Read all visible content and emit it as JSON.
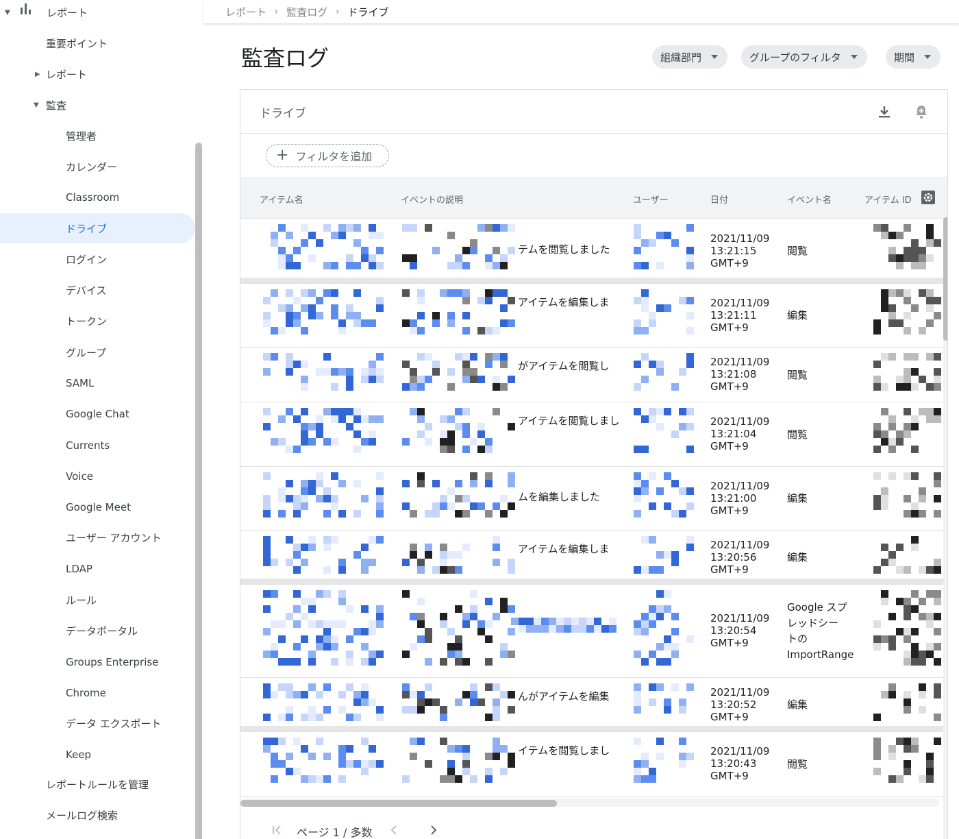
{
  "sidebar": {
    "reports_root": "レポート",
    "highlights": "重要ポイント",
    "reports": "レポート",
    "audit": "監査",
    "audit_items": [
      "管理者",
      "カレンダー",
      "Classroom",
      "ドライブ",
      "ログイン",
      "デバイス",
      "トークン",
      "グループ",
      "SAML",
      "Google Chat",
      "Currents",
      "Voice",
      "Google Meet",
      "ユーザー アカウント",
      "LDAP",
      "ルール",
      "データポータル",
      "Groups Enterprise",
      "Chrome",
      "データ エクスポート",
      "Keep"
    ],
    "active_item": "ドライブ",
    "manage_rules": "レポートルールを管理",
    "email_log": "メールログ検索"
  },
  "breadcrumb": [
    "レポート",
    "監査ログ",
    "ドライブ"
  ],
  "page_title": "監査ログ",
  "filters": {
    "org": "組織部門",
    "group": "グループのフィルタ",
    "period": "期間"
  },
  "card": {
    "title": "ドライブ",
    "add_filter": "フィルタを追加",
    "columns": [
      "アイテム名",
      "イベントの説明",
      "ユーザー",
      "日付",
      "イベント名",
      "アイテム ID"
    ],
    "rows": [
      {
        "desc": "テムを閲覧しました",
        "date": [
          "2021/11/09",
          "13:21:15",
          "GMT+9"
        ],
        "event": [
          "閲覧"
        ]
      },
      {
        "desc": "アイテムを編集しま",
        "date": [
          "2021/11/09",
          "13:21:11",
          "GMT+9"
        ],
        "event": [
          "編集"
        ]
      },
      {
        "desc": "がアイテムを閲覧し",
        "date": [
          "2021/11/09",
          "13:21:08",
          "GMT+9"
        ],
        "event": [
          "閲覧"
        ]
      },
      {
        "desc": "アイテムを閲覧しまし",
        "date": [
          "2021/11/09",
          "13:21:04",
          "GMT+9"
        ],
        "event": [
          "閲覧"
        ]
      },
      {
        "desc": "ムを編集しました",
        "date": [
          "2021/11/09",
          "13:21:00",
          "GMT+9"
        ],
        "event": [
          "編集"
        ]
      },
      {
        "desc": "アイテムを編集しま",
        "date": [
          "2021/11/09",
          "13:20:56",
          "GMT+9"
        ],
        "event": [
          "編集"
        ]
      },
      {
        "desc": "",
        "date": [
          "2021/11/09",
          "13:20:54",
          "GMT+9"
        ],
        "event": [
          "Google スプ",
          "レッドシー",
          "トの",
          "ImportRange"
        ]
      },
      {
        "desc": "んがアイテムを編集",
        "date": [
          "2021/11/09",
          "13:20:52",
          "GMT+9"
        ],
        "event": [
          "編集"
        ]
      },
      {
        "desc": "イテムを閲覧しまし",
        "date": [
          "2021/11/09",
          "13:20:43",
          "GMT+9"
        ],
        "event": [
          "閲覧"
        ]
      }
    ]
  },
  "pager": {
    "label": "ページ 1 / 多数"
  },
  "colors": {
    "accent": "#1a73e8",
    "active_bg": "#e8f0fe"
  }
}
